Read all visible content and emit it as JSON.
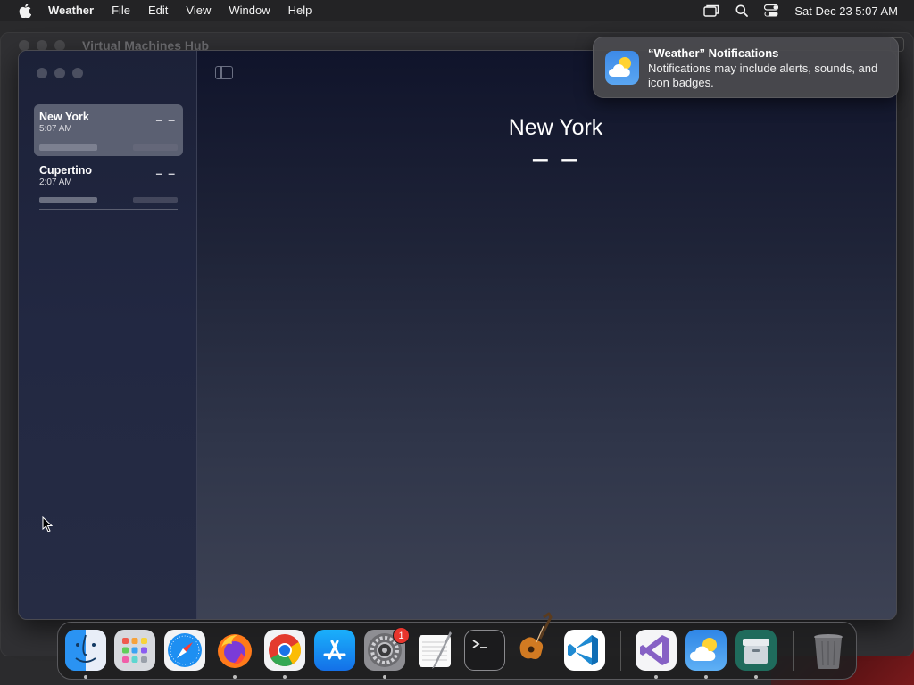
{
  "menubar": {
    "app_name": "Weather",
    "menus": [
      "File",
      "Edit",
      "View",
      "Window",
      "Help"
    ],
    "clock": "Sat Dec 23  5:07 AM"
  },
  "background_window": {
    "title": "Virtual Machines Hub"
  },
  "weather": {
    "cities": [
      {
        "name": "New York",
        "time": "5:07 AM",
        "temp": "– –",
        "selected": true
      },
      {
        "name": "Cupertino",
        "time": "2:07 AM",
        "temp": "– –",
        "selected": false
      }
    ],
    "main": {
      "city": "New York",
      "temp": "– –"
    }
  },
  "notification": {
    "title": "“Weather” Notifications",
    "body": "Notifications may include alerts, sounds, and icon badges."
  },
  "dock": {
    "apps": [
      "finder-icon",
      "launchpad-icon",
      "safari-icon",
      "firefox-icon",
      "chrome-icon",
      "app-store-icon",
      "system-settings-icon",
      "textedit-icon",
      "terminal-icon",
      "garageband-icon",
      "vscode-icon",
      "visual-studio-icon",
      "weather-icon",
      "archive-icon",
      "trash-icon"
    ],
    "settings_badge": "1"
  }
}
